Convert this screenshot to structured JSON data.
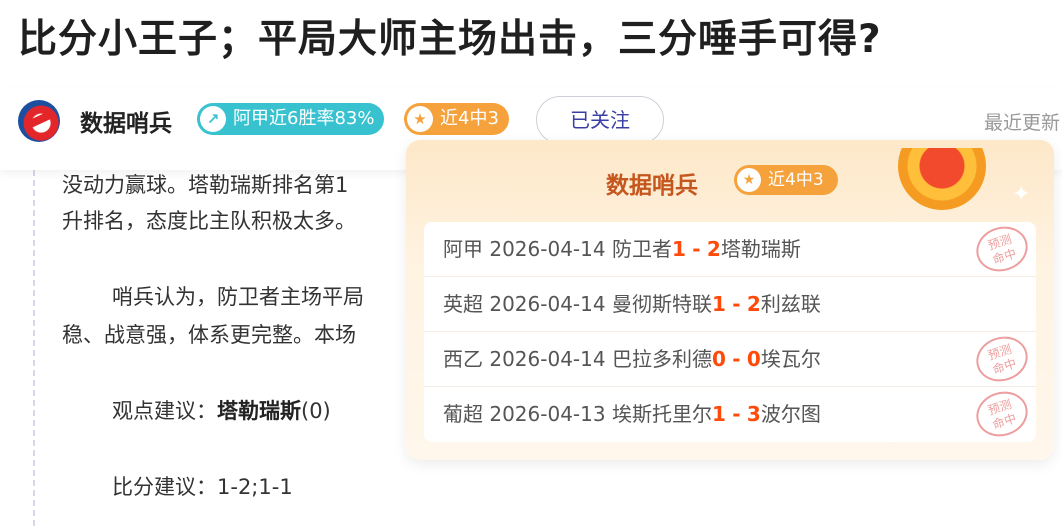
{
  "article": {
    "title": "比分小王子；平局大师主场出击，三分唾手可得?"
  },
  "author": {
    "name": "数据哨兵",
    "badges": [
      {
        "icon": "arrow-up-icon",
        "label": "阿甲近6胜率83%",
        "color": "#38c2cf"
      },
      {
        "icon": "star-icon",
        "label": "近4中3",
        "color": "#f5a23c"
      }
    ],
    "follow_label": "已关注",
    "recent_label": "最近更新"
  },
  "content": {
    "para1_line1": "没动力赢球。塔勒瑞斯排名第1",
    "para1_line2": "升排名，态度比主队积极太多。",
    "para2_line1": "哨兵认为，防卫者主场平局",
    "para2_line2": "稳、战意强，体系更完整。本场",
    "view_label": "观点建议：",
    "view_team": "塔勒瑞斯",
    "view_handicap": "(0)",
    "score_label": "比分建议：",
    "score_value": "1-2;1-1"
  },
  "popup": {
    "title": "数据哨兵",
    "badge": "近4中3",
    "records": [
      {
        "league": "阿甲",
        "date": "2026-04-14",
        "home": "防卫者",
        "home_score": "1",
        "sep": "-",
        "away_score": "2",
        "away": "塔勒瑞斯",
        "stamp": "预测命中",
        "hit": true
      },
      {
        "league": "英超",
        "date": "2026-04-14",
        "home": "曼彻斯特联",
        "home_score": "1",
        "sep": "-",
        "away_score": "2",
        "away": "利兹联",
        "stamp": "",
        "hit": false
      },
      {
        "league": "西乙",
        "date": "2026-04-14",
        "home": "巴拉多利德",
        "home_score": "0",
        "sep": "-",
        "away_score": "0",
        "away": "埃瓦尔",
        "stamp": "预测命中",
        "hit": true
      },
      {
        "league": "葡超",
        "date": "2026-04-13",
        "home": "埃斯托里尔",
        "home_score": "1",
        "sep": "-",
        "away_score": "3",
        "away": "波尔图",
        "stamp": "预测命中",
        "hit": true
      }
    ]
  }
}
